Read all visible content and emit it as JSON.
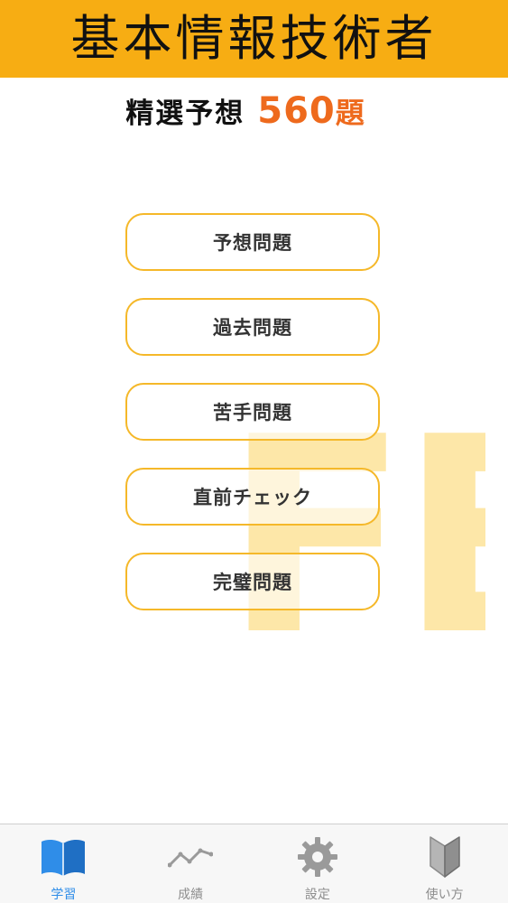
{
  "header": {
    "title": "基本情報技術者"
  },
  "subtitle": {
    "label": "精選予想",
    "count": "560",
    "unit": "題"
  },
  "watermark": {
    "text": "FE"
  },
  "menu": {
    "items": [
      {
        "label": "予想問題"
      },
      {
        "label": "過去問題"
      },
      {
        "label": "苦手問題"
      },
      {
        "label": "直前チェック"
      },
      {
        "label": "完璧問題"
      }
    ]
  },
  "tabbar": {
    "active": "学習",
    "items": [
      {
        "label": "学習",
        "icon": "book-icon"
      },
      {
        "label": "成績",
        "icon": "chart-icon"
      },
      {
        "label": "設定",
        "icon": "gear-icon"
      },
      {
        "label": "使い方",
        "icon": "beginner-mark-icon"
      }
    ]
  },
  "colors": {
    "header": "#f7ad13",
    "accent": "#ee6a1d",
    "button_border": "#f5b829",
    "watermark": "#fde7a8",
    "tab_active": "#2f8de8",
    "tab_inactive": "#8e8e8e"
  }
}
